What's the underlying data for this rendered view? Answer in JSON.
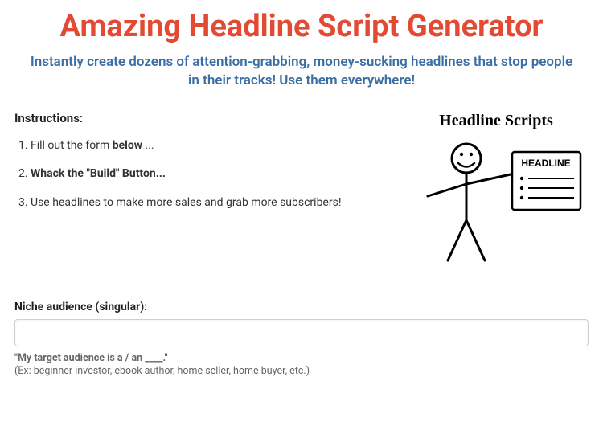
{
  "title": "Amazing Headline Script Generator",
  "subtitle": "Instantly create dozens of attention-grabbing, money-sucking headlines that stop people in their tracks! Use them everywhere!",
  "instructions_label": "Instructions:",
  "instructions": {
    "item1_prefix": "Fill out the form ",
    "item1_bold": "below",
    "item1_suffix": " ...",
    "item2": "Whack the \"Build\" Button...",
    "item3": "Use headlines to make more sales and grab more subscribers!"
  },
  "illustration": {
    "title": "Headline Scripts",
    "card_label": "HEADLINE"
  },
  "form": {
    "niche_label": "Niche audience (singular):",
    "niche_value": "",
    "niche_helper_bold": "\"My target audience is a / an ____.\"",
    "niche_helper_example": "(Ex: beginner investor, ebook author, home seller, home buyer, etc.)"
  }
}
